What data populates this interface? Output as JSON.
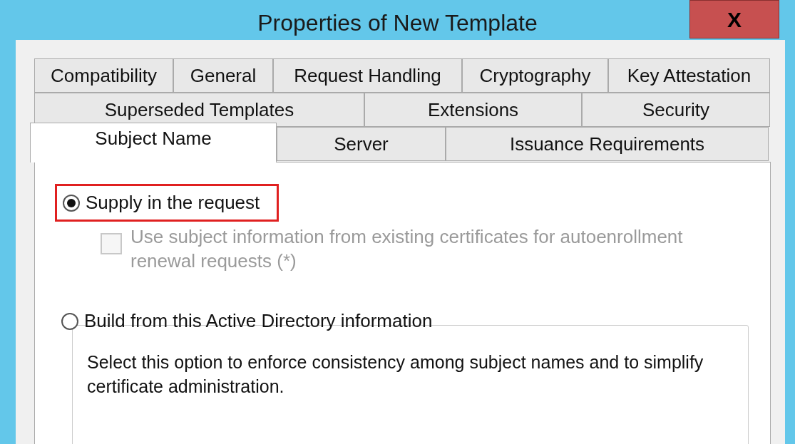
{
  "window": {
    "title": "Properties of New Template",
    "close": "X"
  },
  "tab_rows": [
    [
      {
        "label": "Compatibility",
        "selected": false
      },
      {
        "label": "General",
        "selected": false
      },
      {
        "label": "Request Handling",
        "selected": false
      },
      {
        "label": "Cryptography",
        "selected": false
      },
      {
        "label": "Key Attestation",
        "selected": false
      }
    ],
    [
      {
        "label": "Superseded Templates",
        "selected": false
      },
      {
        "label": "Extensions",
        "selected": false
      },
      {
        "label": "Security",
        "selected": false
      }
    ],
    [
      {
        "label": "Subject Name",
        "selected": true
      },
      {
        "label": "Server",
        "selected": false
      },
      {
        "label": "Issuance Requirements",
        "selected": false
      }
    ]
  ],
  "options": [
    {
      "kind": "radio",
      "label": "Supply in the request",
      "selected": true,
      "highlighted": true
    },
    {
      "kind": "checkbox",
      "label": "Use subject information from existing certificates for autoenrollment renewal requests (*)",
      "checked": false,
      "disabled": true
    },
    {
      "kind": "radio",
      "label": "Build from this Active Directory information",
      "selected": false,
      "highlighted": false
    }
  ],
  "group_box": {
    "text": "Select this option to enforce consistency among subject names and to simplify certificate administration."
  }
}
